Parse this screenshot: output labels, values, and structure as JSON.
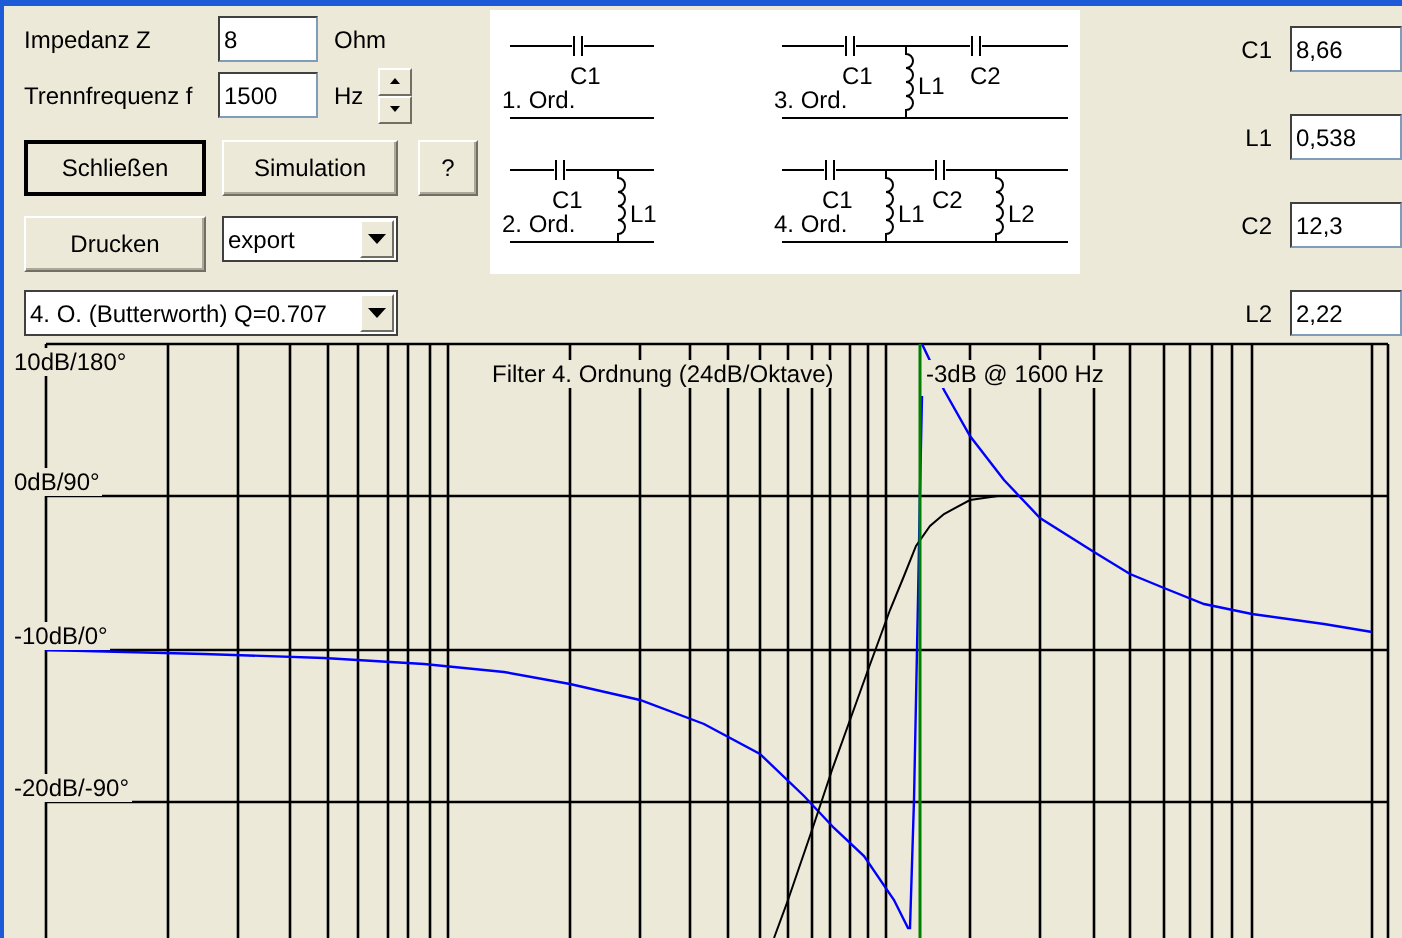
{
  "fields": [
    {
      "label": "Impedanz Z",
      "value": "8",
      "unit": "Ohm",
      "spinner": false
    },
    {
      "label": "Trennfrequenz f",
      "value": "1500",
      "unit": "Hz",
      "spinner": true
    }
  ],
  "buttons": [
    {
      "label": "Schließen",
      "default": true
    },
    {
      "label": "Simulation",
      "default": false
    },
    {
      "label": "?",
      "default": false
    }
  ],
  "print_button": {
    "label": "Drucken",
    "default": false
  },
  "export_dropdown": {
    "value": "export"
  },
  "filter_dropdown": {
    "value": "4. O. (Butterworth) Q=0.707"
  },
  "circuits": [
    {
      "kind": "order1",
      "order_label": "1. Ord.",
      "components": [
        "C1"
      ]
    },
    {
      "kind": "order3",
      "order_label": "3. Ord.",
      "components": [
        "C1",
        "L1",
        "C2"
      ]
    },
    {
      "kind": "order2",
      "order_label": "2. Ord.",
      "components": [
        "C1",
        "L1"
      ]
    },
    {
      "kind": "order4",
      "order_label": "4. Ord.",
      "components": [
        "C1",
        "L1",
        "C2",
        "L2"
      ]
    }
  ],
  "component_values": [
    {
      "label": "C1",
      "value": "8,66"
    },
    {
      "label": "L1",
      "value": "0,538"
    },
    {
      "label": "C2",
      "value": "12,3"
    },
    {
      "label": "L2",
      "value": "2,22"
    }
  ],
  "plot": {
    "title": "Filter 4. Ordnung (24dB/Oktave)",
    "marker_label": "-3dB @ 1600 Hz",
    "y_labels": [
      "10dB/180°",
      "0dB/90°",
      "-10dB/0°",
      "-20dB/-90°"
    ]
  }
}
